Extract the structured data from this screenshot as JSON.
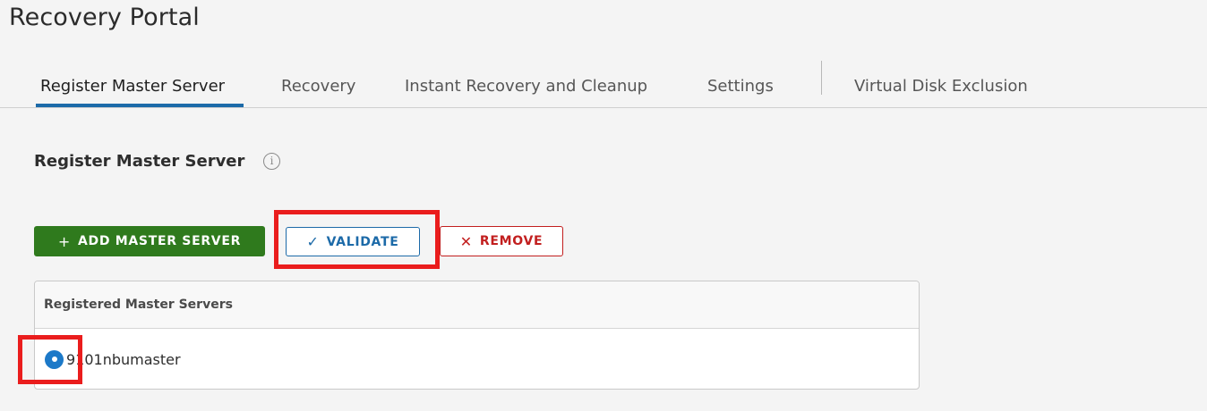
{
  "page": {
    "title": "Recovery Portal"
  },
  "tabs": [
    {
      "label": "Register Master Server",
      "active": true
    },
    {
      "label": "Recovery",
      "active": false
    },
    {
      "label": "Instant Recovery and Cleanup",
      "active": false
    },
    {
      "label": "Settings",
      "active": false
    },
    {
      "label": "Virtual Disk Exclusion",
      "active": false
    }
  ],
  "section": {
    "title": "Register Master Server",
    "info_icon": "info-circle-icon"
  },
  "toolbar": {
    "add_label": "ADD MASTER SERVER",
    "add_icon": "+",
    "validate_label": "VALIDATE",
    "validate_icon": "✓",
    "remove_label": "REMOVE",
    "remove_icon": "✕"
  },
  "grid": {
    "header": "Registered Master Servers",
    "rows": [
      {
        "name": "9101nbumaster",
        "selected": true
      }
    ]
  },
  "colors": {
    "accent_blue": "#1c6aa8",
    "add_green": "#2f7a1d",
    "remove_red": "#c21f1f",
    "annotation_red": "#ea1d1d"
  }
}
